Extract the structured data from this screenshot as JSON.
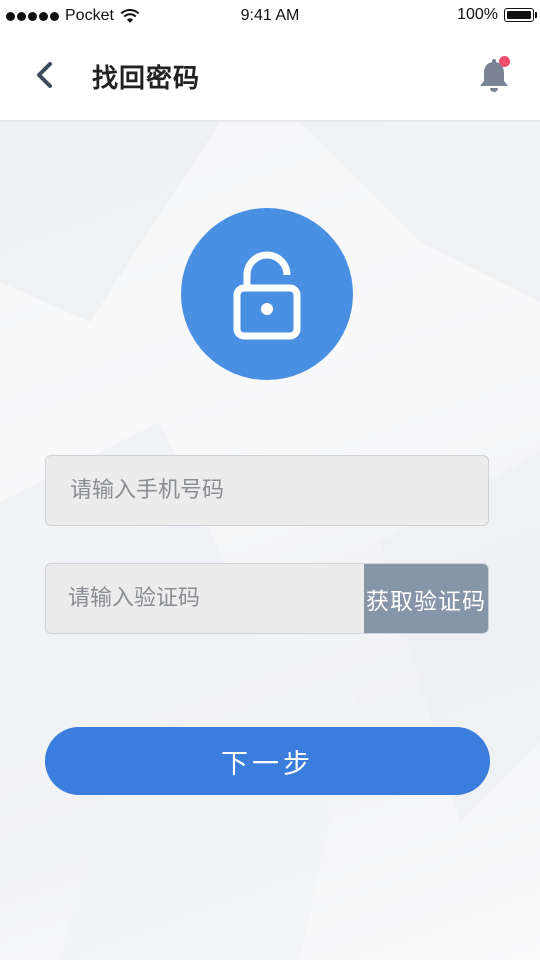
{
  "status_bar": {
    "carrier": "Pocket",
    "time": "9:41 AM",
    "battery": "100%"
  },
  "nav": {
    "title": "找回密码",
    "back_icon": "chevron-left-icon",
    "bell_icon": "bell-icon",
    "has_notification": true
  },
  "form": {
    "phone_placeholder": "请输入手机号码",
    "code_placeholder": "请输入验证码",
    "get_code_label": "获取验证码",
    "next_label": "下一步"
  },
  "colors": {
    "accent": "#3a7ddd",
    "lock_circle": "#4a90e2",
    "get_code_button": "#8795a8",
    "badge": "#f0506e"
  },
  "icons": {
    "lock": "unlocked-padlock-icon"
  }
}
